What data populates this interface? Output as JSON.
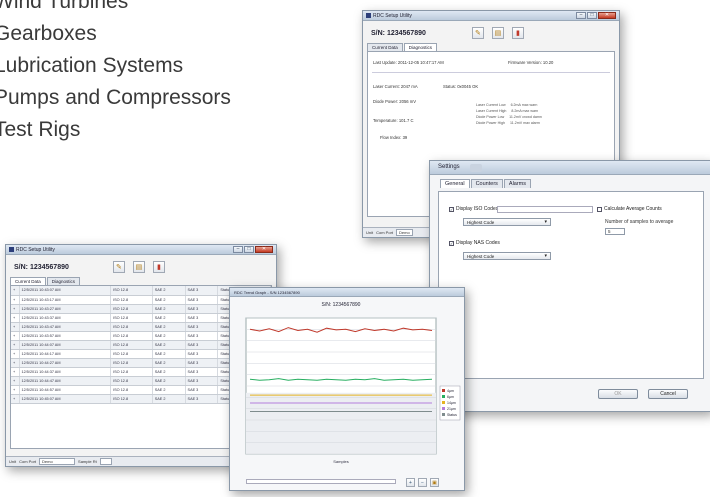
{
  "applications": [
    "Wind Turbines",
    "Gearboxes",
    "Lubrication Systems",
    "Pumps and Compressors",
    "Test Rigs"
  ],
  "diag_window": {
    "title": "RDC Setup Utility",
    "sn": "S/N: 1234567890",
    "tabs": [
      "Current Data",
      "Diagnostics"
    ],
    "last_update": "Last Update: 2011-12-05 10:47:17 AM",
    "firmware": "Firmware Version: 10.20",
    "laser_current": "Laser Current: 2047 mA",
    "status": "Status: 0x0045 OK",
    "diode_power": "Diode Power: 2056 mV",
    "temperature": "Temperature: 101.7 C",
    "flow_index": "Flow Index: 39",
    "right_grid": [
      [
        "Laser Current Low",
        "6.2mA max warn"
      ],
      [
        "Laser Current High",
        "8.2mA max warn"
      ],
      [
        "Diode Power Low",
        "11.2mV crowd damn"
      ],
      [
        "Diode Power High",
        "11.2mV max alarm"
      ]
    ],
    "bottom_label": "Unit",
    "bottom_value": "Com Port",
    "bottom_value2": "Demo"
  },
  "data_window": {
    "title": "RDC Setup Utility",
    "sn": "S/N: 1234567890",
    "tabs": [
      "Current Data",
      "Diagnostics"
    ],
    "rows": [
      [
        "12/5/2011 10:43:07 AM",
        "ISO 12.8",
        "SAE 2",
        "SAE 3",
        "Status Error"
      ],
      [
        "12/5/2011 10:43:17 AM",
        "ISO 12.8",
        "SAE 2",
        "SAE 3",
        "Status Error"
      ],
      [
        "12/5/2011 10:43:27 AM",
        "ISO 12.8",
        "SAE 2",
        "SAE 3",
        "Status Error"
      ],
      [
        "12/5/2011 10:43:37 AM",
        "ISO 12.8",
        "SAE 2",
        "SAE 3",
        "Status Error"
      ],
      [
        "12/5/2011 10:43:47 AM",
        "ISO 12.8",
        "SAE 2",
        "SAE 3",
        "Status Error"
      ],
      [
        "12/5/2011 10:43:57 AM",
        "ISO 12.8",
        "SAE 2",
        "SAE 3",
        "Status Error"
      ],
      [
        "12/5/2011 10:44:07 AM",
        "ISO 12.8",
        "SAE 2",
        "SAE 3",
        "Status Error"
      ],
      [
        "12/5/2011 10:44:17 AM",
        "ISO 12.8",
        "SAE 2",
        "SAE 3",
        "Status Error"
      ],
      [
        "12/5/2011 10:44:27 AM",
        "ISO 12.8",
        "SAE 2",
        "SAE 3",
        "Status Error"
      ],
      [
        "12/5/2011 10:44:37 AM",
        "ISO 12.8",
        "SAE 2",
        "SAE 3",
        "Status Error"
      ],
      [
        "12/5/2011 10:44:47 AM",
        "ISO 12.8",
        "SAE 2",
        "SAE 3",
        "Status Error"
      ],
      [
        "12/5/2011 10:44:57 AM",
        "ISO 12.8",
        "SAE 2",
        "SAE 3",
        "Status Error"
      ],
      [
        "12/5/2011 10:45:07 AM",
        "ISO 12.8",
        "SAE 2",
        "SAE 3",
        "Status Error"
      ]
    ],
    "bottom_label": "Unit",
    "bottom_port": "Com Port",
    "bottom_port_value": "Demo",
    "bottom_rate": "Sample Rt"
  },
  "chart_window": {
    "title": "RDC Trend Graph - S/N 1234567890",
    "chart_title": "S/N: 1234567890",
    "xlabel": "Samples",
    "legend": [
      "4µm",
      "6µm",
      "14µm",
      "21µm",
      "Status"
    ]
  },
  "settings_window": {
    "title": "Settings",
    "tabs": [
      "General",
      "Counters",
      "Alarms"
    ],
    "display_iso": "Display ISO Codes",
    "calc_avg": "Calculate Average Counts",
    "iso_select": "Highest Code",
    "samples_label": "Number of samples to average",
    "samples_value": "5",
    "display_nas": "Display NAS Codes",
    "nas_select": "Highest Code",
    "ok": "OK",
    "cancel": "Cancel"
  },
  "chart_data": {
    "type": "line",
    "title": "S/N: 1234567890",
    "xlabel": "Samples",
    "ylabel": "",
    "ylim": [
      0,
      24
    ],
    "x": [
      1,
      2,
      3,
      4,
      5,
      6,
      7,
      8,
      9,
      10,
      11,
      12,
      13,
      14,
      15,
      16,
      17,
      18,
      19,
      20
    ],
    "series": [
      {
        "name": "4µm",
        "color": "#c0392b",
        "values": [
          22,
          21.7,
          22.1,
          21.6,
          22.3,
          21.8,
          22.0,
          21.5,
          22.2,
          21.9,
          22.0,
          21.6,
          22.1,
          21.8,
          22.0,
          21.7,
          22.2,
          21.9,
          22.0,
          21.8
        ]
      },
      {
        "name": "6µm",
        "color": "#27ae60",
        "values": [
          13.2,
          13.0,
          13.1,
          13.3,
          13.0,
          13.2,
          13.1,
          13.0,
          13.2,
          13.1,
          13.0,
          13.2,
          13.1,
          13.3,
          13.0,
          13.1,
          13.2,
          13.0,
          13.1,
          13.2
        ]
      },
      {
        "name": "14µm",
        "color": "#e6b422",
        "values": [
          10.4,
          10.4,
          10.4,
          10.4,
          10.4,
          10.4,
          10.4,
          10.4,
          10.4,
          10.4,
          10.4,
          10.4,
          10.4,
          10.4,
          10.4,
          10.4,
          10.4,
          10.4,
          10.4,
          10.4
        ]
      },
      {
        "name": "21µm",
        "color": "#b57edc",
        "values": [
          9.0,
          9.0,
          9.0,
          9.0,
          9.0,
          9.0,
          9.0,
          9.0,
          9.0,
          9.0,
          9.0,
          9.0,
          9.0,
          9.0,
          9.0,
          9.0,
          9.0,
          9.0,
          9.0,
          9.0
        ]
      },
      {
        "name": "Status",
        "color": "#7f8c8d",
        "values": [
          7.5,
          7.5,
          7.5,
          7.5,
          7.5,
          7.5,
          7.5,
          7.5,
          7.5,
          7.5,
          7.5,
          7.5,
          7.5,
          7.5,
          7.5,
          7.5,
          7.5,
          7.5,
          7.5,
          7.5
        ]
      }
    ],
    "grid": true,
    "legend_position": "right"
  }
}
